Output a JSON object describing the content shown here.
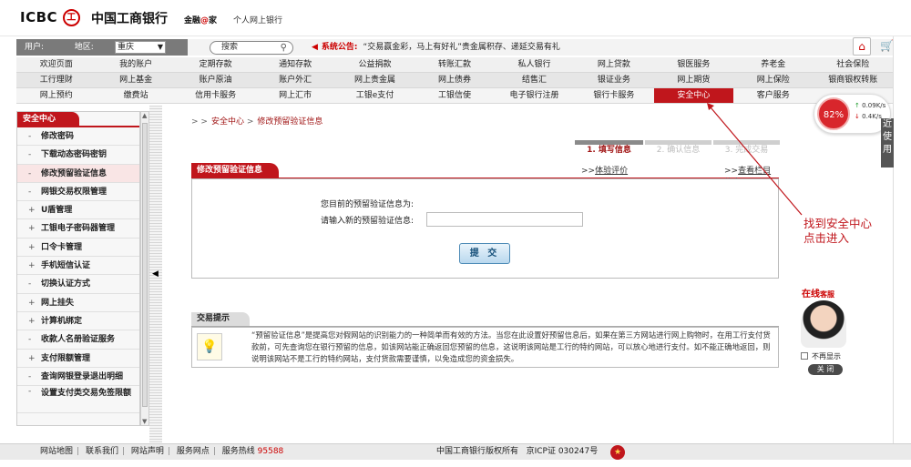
{
  "header": {
    "logo_text": "ICBC",
    "logo_symbol": "工",
    "bank_name": "中国工商银行",
    "slogan_prefix": "金融",
    "slogan_at": "@",
    "slogan_suffix": "家",
    "personal_banking": "个人网上银行"
  },
  "infobar": {
    "user_label": "用户:",
    "region_label": "地区:",
    "region_value": "重庆",
    "search_placeholder": "搜索",
    "notice_label": "系统公告:",
    "notice_text": "“交易赢金彩，马上有好礼”贵金属积存、递延交易有礼"
  },
  "nav": {
    "row1": [
      "欢迎页面",
      "我的账户",
      "定期存款",
      "通知存款",
      "公益捐款",
      "转账汇款",
      "私人银行",
      "网上贷款",
      "银医服务",
      "养老金",
      "社会保险"
    ],
    "row2": [
      "工行理财",
      "网上基金",
      "账户原油",
      "账户外汇",
      "网上贵金属",
      "网上债券",
      "结售汇",
      "银证业务",
      "网上期货",
      "网上保险",
      "银商银权转账"
    ],
    "row3": [
      "网上预约",
      "缴费站",
      "信用卡服务",
      "网上汇市",
      "工银e支付",
      "工银信使",
      "电子银行注册",
      "银行卡服务",
      "安全中心",
      "客户服务"
    ],
    "active": "安全中心"
  },
  "speed": {
    "percent": "82%",
    "up": "0.09K/s",
    "down": "0.4K/s",
    "up_arrow": "↑",
    "down_arrow": "↓"
  },
  "sidebar": {
    "title": "安全中心",
    "items": [
      "修改密码",
      "下载动态密码密钥",
      "修改预留验证信息",
      "网银交易权限管理",
      "U盾管理",
      "工银电子密码器管理",
      "口令卡管理",
      "手机短信认证",
      "切换认证方式",
      "网上挂失",
      "计算机绑定",
      "收款人名册验证服务",
      "支付限额管理",
      "查询网银登录退出明细",
      "设置支付类交易免签限额"
    ],
    "selected": "修改预留验证信息"
  },
  "breadcrumb": {
    "prefix": "> >",
    "section": "安全中心",
    "arrow": ">",
    "page": "修改预留验证信息"
  },
  "steps": [
    "1. 填写信息",
    "2. 确认信息",
    "3. 完成交易"
  ],
  "form": {
    "title": "修改预留验证信息",
    "eval_link": "体验评价",
    "help_link": "查看栏目信息",
    "current_label": "您目前的预留验证信息为:",
    "new_label": "请输入新的预留验证信息:",
    "new_value": "",
    "submit_label": "提 交"
  },
  "tips": {
    "title": "交易提示",
    "text": "“预留验证信息”是提高您对假网站的识别能力的一种简单而有效的方法。当您在此设置好预留信息后，如果在第三方网站进行网上购物时，在用工行支付货款前，可先查询您在银行预留的信息，如该网站能正确返回您预留的信息，这说明该网站是工行的特约网站，可以放心地进行支付。如不能正确地返回，则说明该网站不是工行的特约网站，支付货款需要谨慎，以免造成您的资金损失。"
  },
  "service": {
    "title_a": "在线",
    "title_b": "客服",
    "no_show": "不再显示",
    "close": "关 闭"
  },
  "right_tab": "近使用",
  "annotation": {
    "line1": "找到安全中心",
    "line2": "点击进入"
  },
  "footer": {
    "sitemap": "网站地图",
    "contact": "联系我们",
    "statement": "网站声明",
    "outlets": "服务网点",
    "hotline_label": "服务热线",
    "hotline": "95588",
    "copyright": "中国工商银行版权所有",
    "icp": "京ICP证 030247号",
    "sep": "|"
  },
  "colors": {
    "brand_red": "#c0161c",
    "annotation_red": "#c0161c"
  }
}
